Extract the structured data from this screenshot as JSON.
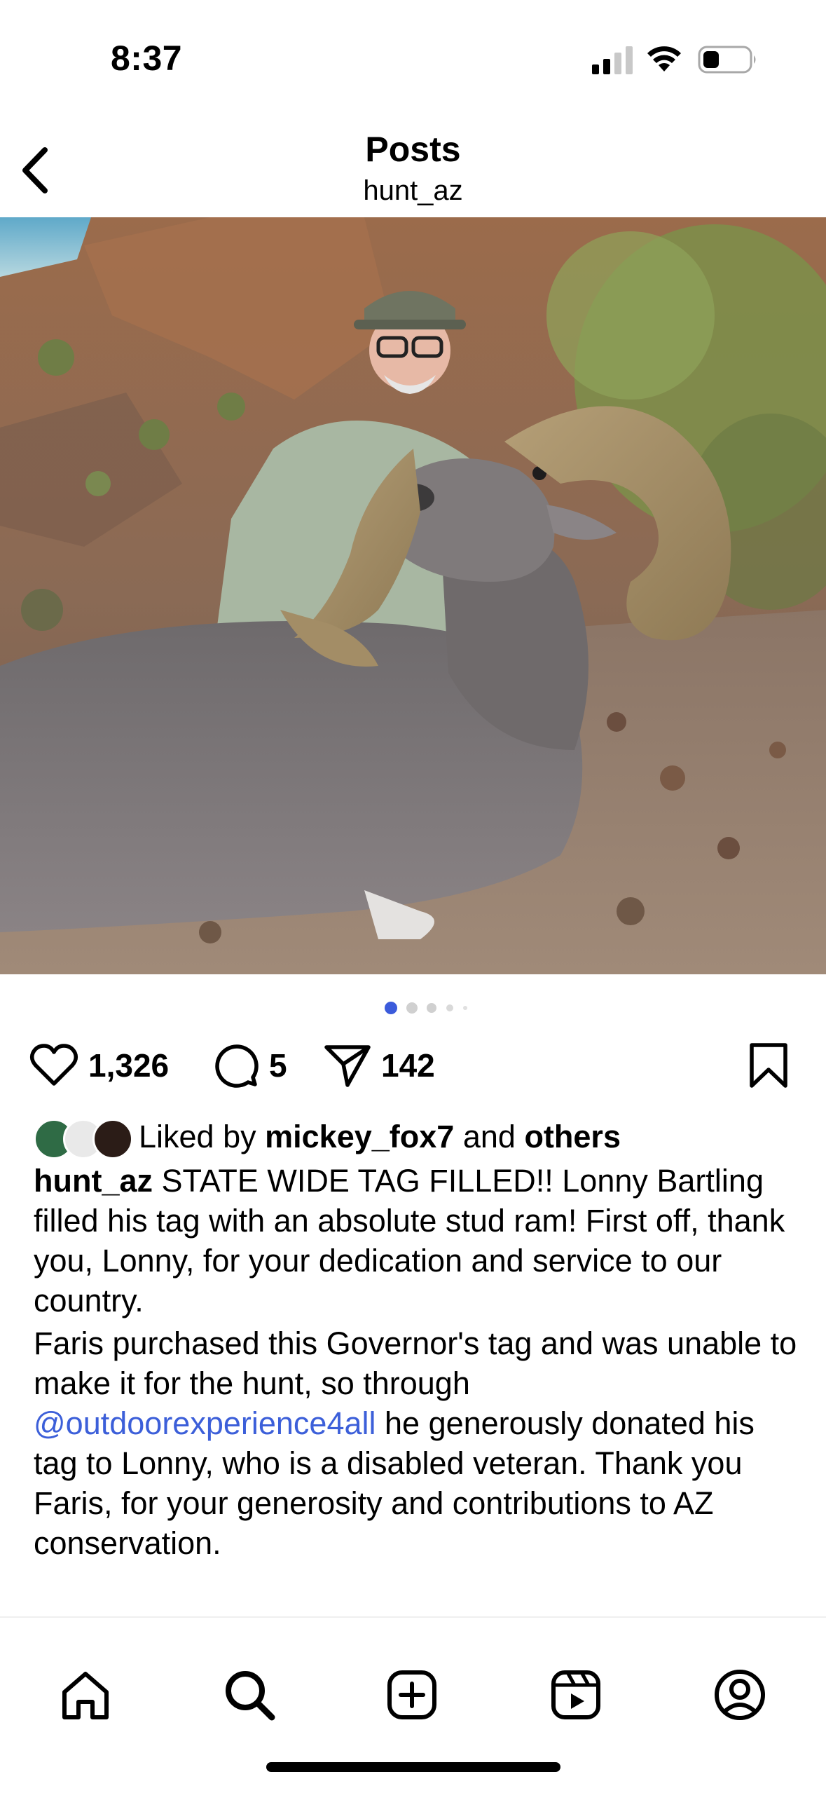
{
  "status_bar": {
    "time": "8:37",
    "icons": [
      "cellular-signal-icon",
      "wifi-icon",
      "battery-icon"
    ]
  },
  "header": {
    "title": "Posts",
    "subtitle": "hunt_az",
    "back_icon": "chevron-left-icon"
  },
  "post": {
    "image_alt": "Hunter kneeling behind a bighorn ram on a rocky desert hillside",
    "carousel": {
      "total": 5,
      "active_index": 0
    },
    "likes": "1,326",
    "comments": "5",
    "shares": "142",
    "liked_by": {
      "prefix": "Liked by",
      "user": "mickey_fox7",
      "and": "and",
      "others": "others"
    },
    "caption": {
      "username": "hunt_az",
      "para1": "STATE WIDE TAG FILLED!! Lonny Bartling filled his tag with an absolute stud ram! First off, thank you, Lonny, for your dedication and service to our country.",
      "para2_before": "Faris purchased this Governor's tag and was unable to make it for the hunt, so through",
      "mention": "@outdoorexperience4all",
      "para2_after": "he generously donated his tag to Lonny, who is a disabled veteran. Thank you Faris, for your generosity and contributions to AZ conservation."
    }
  },
  "bottom_nav": {
    "items": [
      "home-icon",
      "search-icon",
      "create-icon",
      "reels-icon",
      "profile-icon"
    ]
  },
  "colors": {
    "accent_blue": "#3c5fd9",
    "dot_active": "#3b5bdb",
    "dot_inactive": "#d0d0d0"
  }
}
